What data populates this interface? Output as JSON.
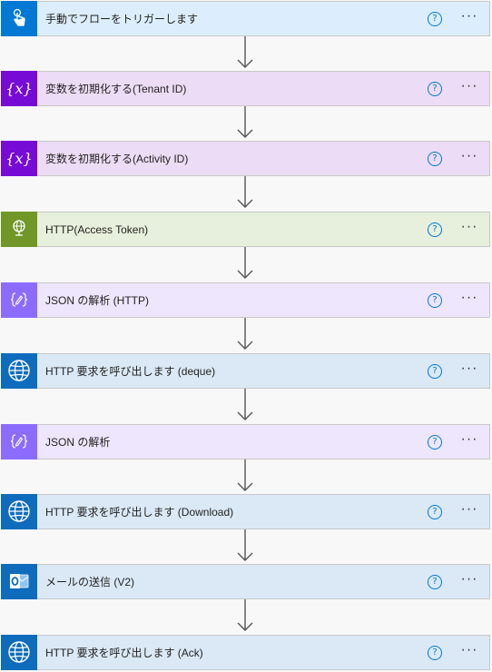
{
  "steps": [
    {
      "label": "手動でフローをトリガーします",
      "icon": "touch-trigger-icon",
      "bg": "#dceefd",
      "iconBg": "#0078d4"
    },
    {
      "label": "変数を初期化する(Tenant ID)",
      "icon": "variable-icon",
      "bg": "#eddcf5",
      "iconBg": "#770bd6"
    },
    {
      "label": "変数を初期化する(Activity ID)",
      "icon": "variable-icon",
      "bg": "#eddcf5",
      "iconBg": "#770bd6"
    },
    {
      "label": "HTTP(Access Token)",
      "icon": "http-globe-icon",
      "bg": "#e7f0dc",
      "iconBg": "#709727"
    },
    {
      "label": "JSON の解析 (HTTP)",
      "icon": "data-operation-icon",
      "bg": "#ede6fc",
      "iconBg": "#8c6cff"
    },
    {
      "label": "HTTP 要求を呼び出します (deque)",
      "icon": "http-request-icon",
      "bg": "#dbe9f6",
      "iconBg": "#0f6cbd"
    },
    {
      "label": "JSON の解析",
      "icon": "data-operation-icon",
      "bg": "#ede6fc",
      "iconBg": "#8c6cff"
    },
    {
      "label": "HTTP 要求を呼び出します (Download)",
      "icon": "http-request-icon",
      "bg": "#dbe9f6",
      "iconBg": "#0f6cbd"
    },
    {
      "label": "メールの送信 (V2)",
      "icon": "outlook-icon",
      "bg": "#dbe9f6",
      "iconBg": "#0f6cbd"
    },
    {
      "label": "HTTP 要求を呼び出します (Ack)",
      "icon": "http-request-icon",
      "bg": "#dbe9f6",
      "iconBg": "#0f6cbd"
    }
  ],
  "help_glyph": "?",
  "more_glyph": "···"
}
